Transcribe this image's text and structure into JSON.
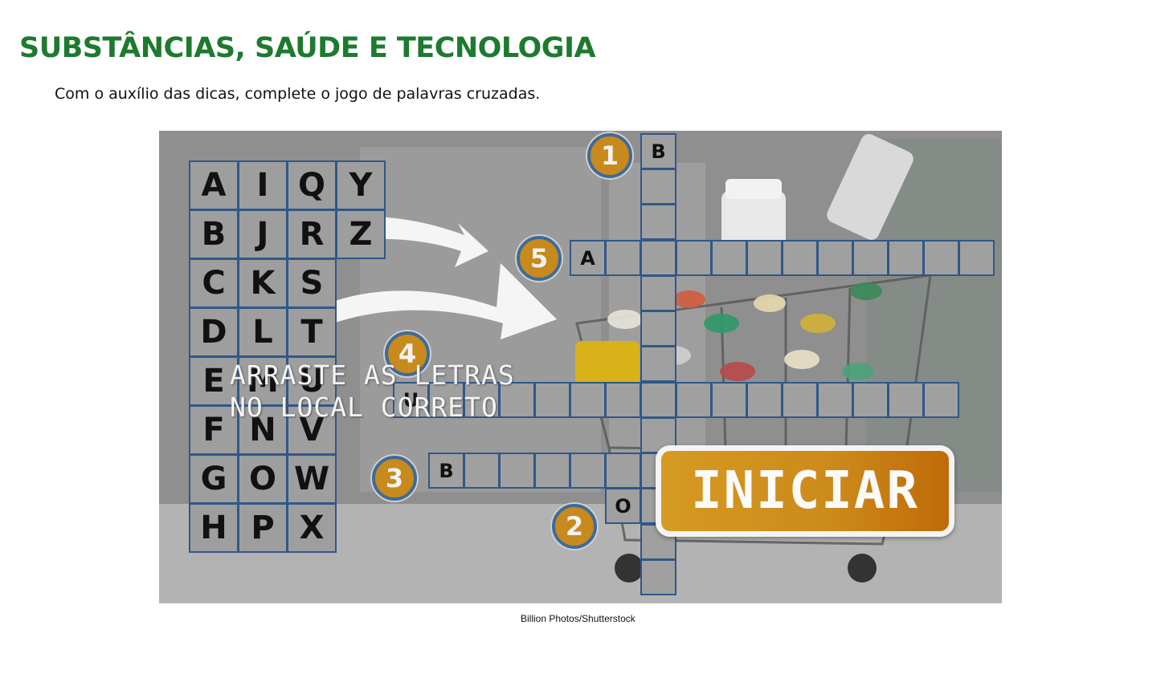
{
  "header": {
    "title": "SUBSTÂNCIAS, SAÚDE E TECNOLOGIA",
    "instruction": "Com o auxílio das dicas, complete o jogo de palavras cruzadas."
  },
  "game": {
    "letter_tiles": [
      [
        "A",
        "I",
        "Q",
        "Y"
      ],
      [
        "B",
        "J",
        "R",
        "Z"
      ],
      [
        "C",
        "K",
        "S"
      ],
      [
        "D",
        "L",
        "T"
      ],
      [
        "E",
        "M",
        "U"
      ],
      [
        "F",
        "N",
        "V"
      ],
      [
        "G",
        "O",
        "W"
      ],
      [
        "H",
        "P",
        "X"
      ]
    ],
    "hint_line1": "ARRASTE AS LETRAS",
    "hint_line2": "NO LOCAL CORRETO",
    "start_label": "INICIAR",
    "clue_numbers": [
      "1",
      "2",
      "3",
      "4",
      "5"
    ],
    "filled_letters": {
      "word1_first": "B",
      "word5_first": "A",
      "word3_first": "B",
      "word2_first": "O",
      "word4_first": "U"
    },
    "colors": {
      "tile_border": "#2f5888",
      "badge_fill": "#c88a1c",
      "button_fill": "#cc8a1a",
      "title_green": "#1d7a2e"
    }
  },
  "credit": "Billion Photos/Shutterstock"
}
